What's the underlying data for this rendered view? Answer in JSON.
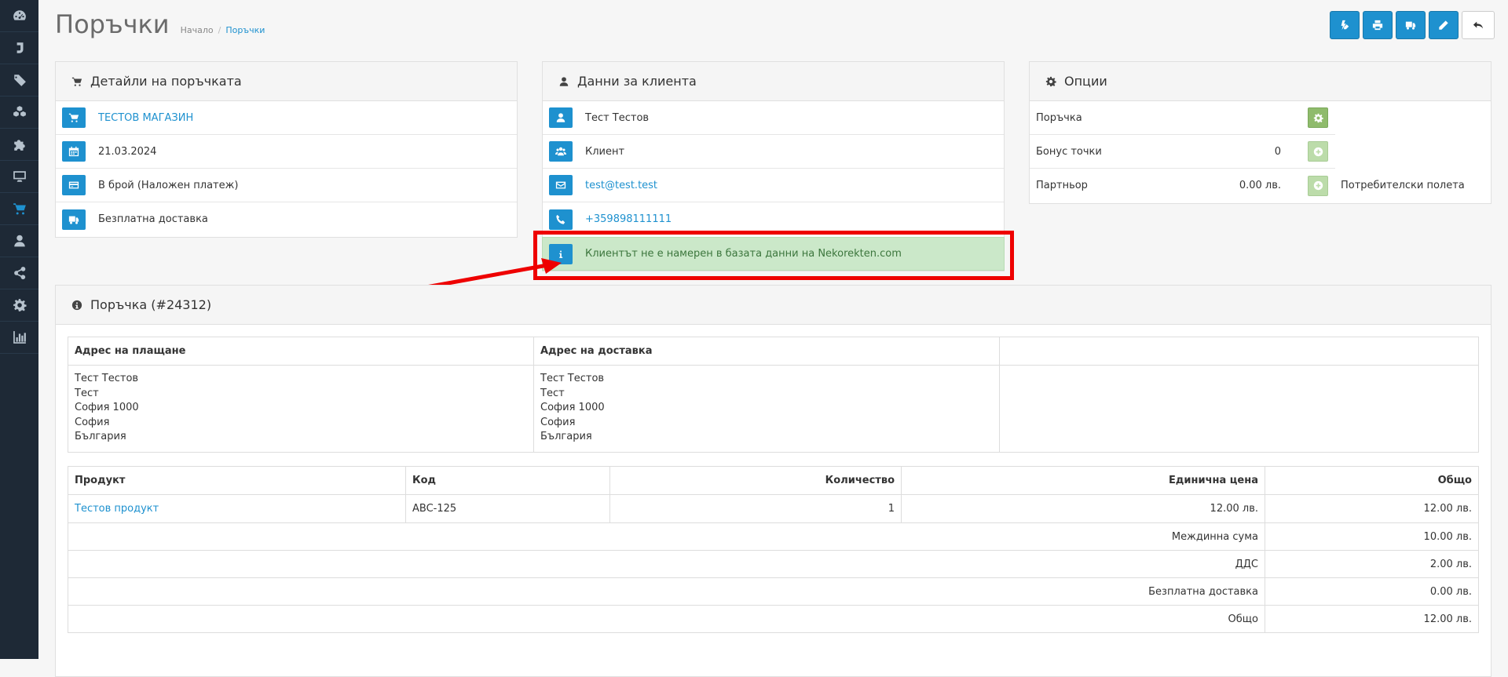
{
  "sidebar": {
    "items": [
      {
        "icon": "dashboard-icon"
      },
      {
        "icon": "j-logo-icon"
      },
      {
        "icon": "tags-icon"
      },
      {
        "icon": "cubes-icon"
      },
      {
        "icon": "puzzle-icon"
      },
      {
        "icon": "desktop-icon"
      },
      {
        "icon": "shopping-cart-icon",
        "active": true
      },
      {
        "icon": "user-icon"
      },
      {
        "icon": "share-icon"
      },
      {
        "icon": "cog-icon"
      },
      {
        "icon": "bar-chart-icon"
      }
    ]
  },
  "header": {
    "title": "Поръчки",
    "breadcrumb_home": "Начало",
    "breadcrumb_sep": "/",
    "breadcrumb_current": "Поръчки"
  },
  "toolbar": {
    "buttons": [
      {
        "icon": "bolt-pencil-icon"
      },
      {
        "icon": "print-icon"
      },
      {
        "icon": "truck-icon"
      },
      {
        "icon": "pencil-icon"
      },
      {
        "icon": "reply-icon"
      }
    ]
  },
  "order_details": {
    "title": "Детайли на поръчката",
    "store": "ТЕСТОВ МАГАЗИН",
    "date": "21.03.2024",
    "payment": "В брой (Наложен платеж)",
    "shipping": "Безплатна доставка"
  },
  "customer": {
    "title": "Данни за клиента",
    "name": "Тест Тестов",
    "group": "Клиент",
    "email": "test@test.test",
    "phone": "+359898111111",
    "notice": "Клиентът не е намерен в базата данни на Nekorekten.com"
  },
  "options": {
    "title": "Опции",
    "order_label": "Поръчка",
    "bonus_label": "Бонус точки",
    "bonus_value": "0",
    "partner_label": "Партньор",
    "partner_value": "0.00 лв.",
    "custom_fields": "Потребителски полета"
  },
  "order": {
    "title": "Поръчка (#24312)",
    "billing_header": "Адрес на плащане",
    "shipping_header": "Адрес на доставка",
    "billing_lines": [
      "Тест Тестов",
      "Тест",
      "София 1000",
      "София",
      "България"
    ],
    "shipping_lines": [
      "Тест Тестов",
      "Тест",
      "София 1000",
      "София",
      "България"
    ],
    "products_headers": {
      "product": "Продукт",
      "code": "Код",
      "quantity": "Количество",
      "unit_price": "Единична цена",
      "total": "Общо"
    },
    "products": [
      {
        "name": "Тестов продукт",
        "code": "ABC-125",
        "quantity": "1",
        "unit_price": "12.00 лв.",
        "total": "12.00 лв."
      }
    ],
    "totals": [
      {
        "label": "Междинна сума",
        "value": "10.00 лв."
      },
      {
        "label": "ДДС",
        "value": "2.00 лв."
      },
      {
        "label": "Безплатна доставка",
        "value": "0.00 лв."
      },
      {
        "label": "Общо",
        "value": "12.00 лв."
      }
    ]
  },
  "colors": {
    "accent": "#1e91cf",
    "sidebar": "#1e2936",
    "notice_bg": "#cbe8c9",
    "highlight": "#e00000"
  }
}
